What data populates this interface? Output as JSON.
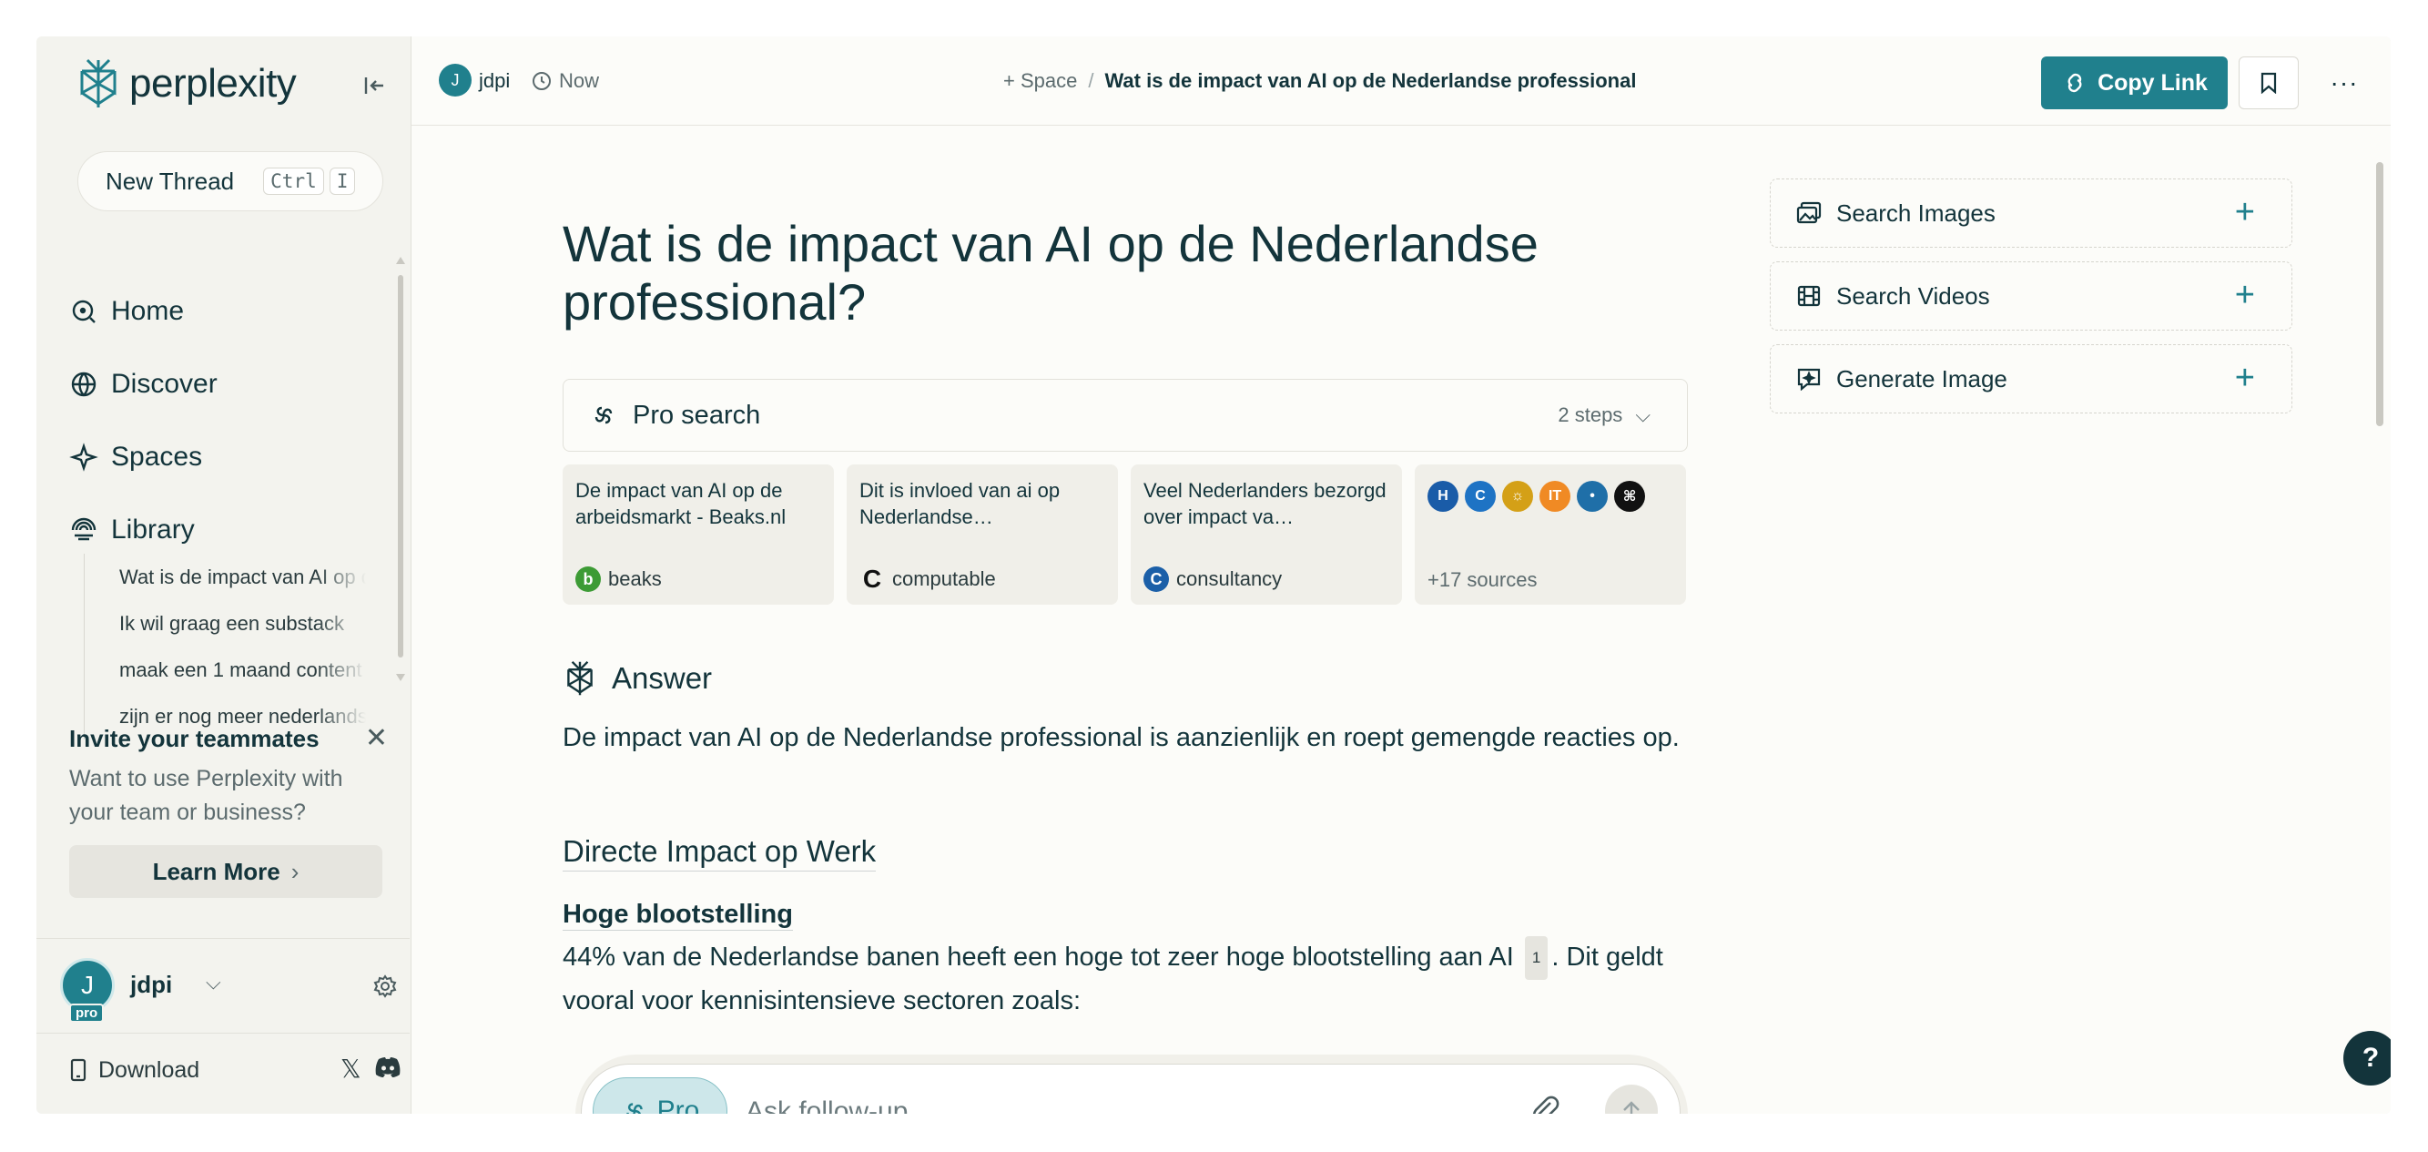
{
  "app": {
    "brand": "perplexity",
    "accent_color": "#20808d"
  },
  "sidebar": {
    "new_thread": {
      "label": "New Thread",
      "shortcut_keys": [
        "Ctrl",
        "I"
      ]
    },
    "nav": [
      {
        "label": "Home",
        "icon": "search-circle-icon"
      },
      {
        "label": "Discover",
        "icon": "globe-icon"
      },
      {
        "label": "Spaces",
        "icon": "sparkle-icon"
      },
      {
        "label": "Library",
        "icon": "library-icon"
      }
    ],
    "library_items": [
      "Wat is de impact van AI op de Nederlandse professional",
      "Ik wil graag een substack",
      "maak een 1 maand content",
      "zijn er nog meer nederlandse"
    ],
    "invite": {
      "title": "Invite your teammates",
      "text": "Want to use Perplexity with your team or business?",
      "button": "Learn More"
    },
    "user": {
      "name": "jdpi",
      "initial": "J",
      "badge": "pro"
    },
    "download_label": "Download"
  },
  "topbar": {
    "user_initial": "J",
    "user_name": "jdpi",
    "time": "Now",
    "space_label": "+ Space",
    "separator": "/",
    "thread_title": "Wat is de impact van AI op de Nederlandse professional",
    "copy_link": "Copy Link"
  },
  "thread": {
    "question": "Wat is de impact van AI op de Nederlandse professional?",
    "pro_search": {
      "label": "Pro search",
      "steps": "2 steps"
    },
    "sources": [
      {
        "title": "De impact van AI op de arbeidsmarkt - Beaks.nl",
        "site": "beaks",
        "fav_color": "#3d9b35",
        "fav_letter": "b"
      },
      {
        "title": "Dit is invloed van ai op Nederlandse…",
        "site": "computable",
        "fav_color": "#111111",
        "fav_letter": "C"
      },
      {
        "title": "Veel Nederlanders bezorgd over impact va…",
        "site": "consultancy",
        "fav_color": "#1b5fa8",
        "fav_letter": "C"
      }
    ],
    "more_sources": {
      "label": "+17 sources",
      "favicons": [
        {
          "letter": "H",
          "color": "#1a5ca8"
        },
        {
          "letter": "C",
          "color": "#1e73c4"
        },
        {
          "letter": "☼",
          "color": "#d4a017"
        },
        {
          "letter": "IT",
          "color": "#f08a24"
        },
        {
          "letter": "•",
          "color": "#1f6fa8"
        },
        {
          "letter": "⌘",
          "color": "#111111"
        }
      ]
    },
    "answer_label": "Answer",
    "answer_intro": "De impact van AI op de Nederlandse professional is aanzienlijk en roept gemengde reacties op.",
    "section_title": "Directe Impact op Werk",
    "subsection_title": "Hoge blootstelling",
    "paragraph_before_cite": "44% van de Nederlandse banen heeft een hoge tot zeer hoge blootstelling aan AI",
    "citation": "1",
    "paragraph_after_cite": ". Dit geldt vooral voor kennisintensieve sectoren zoals:"
  },
  "followup": {
    "pro_label": "Pro",
    "placeholder": "Ask follow-up"
  },
  "side_actions": [
    {
      "label": "Search Images",
      "icon": "image-icon"
    },
    {
      "label": "Search Videos",
      "icon": "film-icon"
    },
    {
      "label": "Generate Image",
      "icon": "generate-image-icon"
    }
  ],
  "help_label": "?"
}
